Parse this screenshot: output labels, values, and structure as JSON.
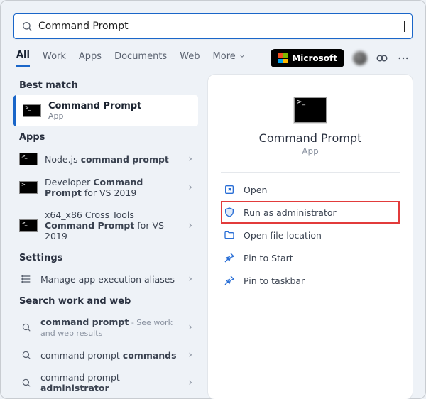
{
  "search": {
    "value": "Command Prompt"
  },
  "tabs": {
    "all": "All",
    "work": "Work",
    "apps": "Apps",
    "documents": "Documents",
    "web": "Web",
    "more": "More"
  },
  "ms_badge": "Microsoft",
  "left": {
    "best_match_head": "Best match",
    "best": {
      "title": "Command Prompt",
      "subtitle": "App"
    },
    "apps_head": "Apps",
    "app1_pre": "Node.js ",
    "app1_b": "command prompt",
    "app2_pre": "Developer ",
    "app2_b": "Command Prompt",
    "app2_post": " for VS 2019",
    "app3_pre": "x64_x86 Cross Tools ",
    "app3_b": "Command Prompt",
    "app3_post": " for VS 2019",
    "settings_head": "Settings",
    "setting1": "Manage app execution aliases",
    "sww_head": "Search work and web",
    "s1_b": "command prompt",
    "s1_post": " - See work and web results",
    "s2_pre": "command prompt ",
    "s2_b": "commands",
    "s3_pre": "command prompt ",
    "s3_b": "administrator"
  },
  "right": {
    "title": "Command Prompt",
    "subtitle": "App",
    "open": "Open",
    "run_admin": "Run as administrator",
    "open_loc": "Open file location",
    "pin_start": "Pin to Start",
    "pin_task": "Pin to taskbar"
  }
}
